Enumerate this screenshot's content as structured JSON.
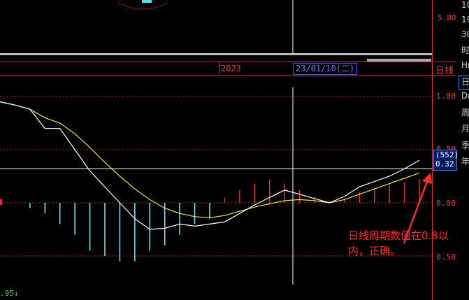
{
  "top_panel": {
    "price_label": "5.80"
  },
  "timeline": {
    "year": "2023",
    "cursor_date": "23/01/10(二)",
    "period": "日线"
  },
  "right_panel": {
    "items": [
      "10",
      "19",
      "30",
      "时",
      "Hr",
      "日",
      "Dr",
      "周",
      "月",
      "季",
      "年"
    ]
  },
  "indicator": {
    "y_ticks": [
      "1.00",
      "0.50",
      "0.00",
      "0.50"
    ],
    "cursor_value_index": "(552)",
    "cursor_value": "0.32"
  },
  "annotation": {
    "text": "日线周期数值在0.8以内，正确。"
  },
  "bottom": {
    "left_value": ".95",
    "left_arrow": "↓"
  },
  "colors": {
    "background": "#000000",
    "axis_red": "#e04040",
    "fast_line": "#ffffff",
    "slow_line": "#e6e65c",
    "positive_bar": "#e03030",
    "negative_bar": "#7ee8f0",
    "annotation": "#ff2a2a",
    "cursor_box": "#3355ff"
  },
  "chart_data": {
    "type": "line",
    "title": "",
    "xlabel": "",
    "ylabel": "",
    "ylim": [
      -0.75,
      1.05
    ],
    "x": [
      0,
      1,
      2,
      3,
      4,
      5,
      6,
      7,
      8,
      9,
      10,
      11,
      12,
      13,
      14,
      15,
      16,
      17,
      18,
      19,
      20,
      21,
      22,
      23,
      24,
      25,
      26,
      27,
      28
    ],
    "series": [
      {
        "role": "fast",
        "values": [
          0.95,
          0.92,
          0.88,
          0.7,
          0.7,
          0.5,
          0.3,
          0.15,
          0.0,
          -0.15,
          -0.25,
          -0.24,
          -0.2,
          -0.22,
          -0.2,
          -0.18,
          -0.1,
          -0.02,
          0.05,
          0.12,
          0.08,
          0.04,
          0.0,
          0.06,
          0.15,
          0.2,
          0.25,
          0.32,
          0.4
        ]
      },
      {
        "role": "slow",
        "values": [
          0.95,
          0.92,
          0.88,
          0.8,
          0.75,
          0.65,
          0.52,
          0.38,
          0.25,
          0.13,
          0.03,
          -0.05,
          -0.1,
          -0.13,
          -0.14,
          -0.12,
          -0.08,
          -0.04,
          -0.01,
          0.02,
          0.03,
          0.02,
          0.0,
          0.03,
          0.08,
          0.13,
          0.18,
          0.23,
          0.28
        ]
      },
      {
        "role": "histogram",
        "values": [
          0.0,
          0.0,
          -0.05,
          -0.1,
          -0.2,
          -0.3,
          -0.45,
          -0.5,
          -0.55,
          -0.55,
          -0.45,
          -0.4,
          -0.3,
          -0.2,
          -0.15,
          0.05,
          0.12,
          0.18,
          0.22,
          0.18,
          0.12,
          0.06,
          0.02,
          0.04,
          0.1,
          0.14,
          0.17,
          0.19,
          0.22
        ]
      }
    ]
  }
}
